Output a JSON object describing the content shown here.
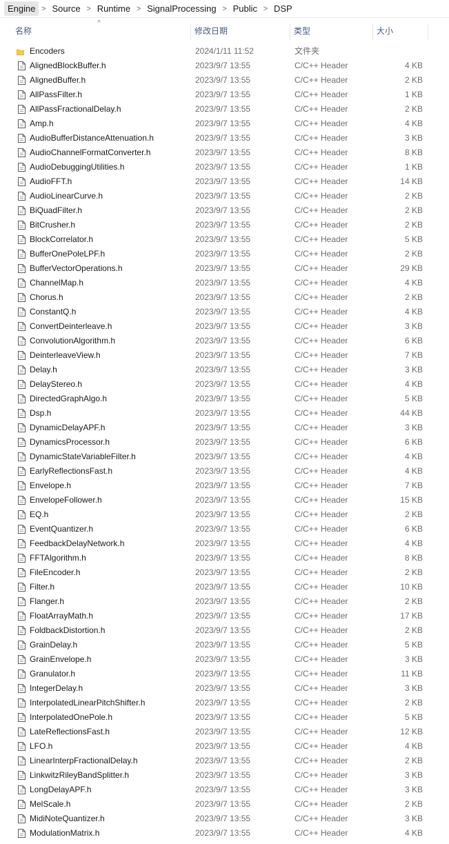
{
  "breadcrumb": [
    "Engine",
    "Source",
    "Runtime",
    "SignalProcessing",
    "Public",
    "DSP"
  ],
  "breadcrumb_separator": ">",
  "columns": {
    "name": "名称",
    "date": "修改日期",
    "type": "类型",
    "size": "大小"
  },
  "sort_indicator": "^",
  "icons": {
    "folder": "folder-icon",
    "file": "header-file-icon",
    "folder_color": "#f4c94e",
    "file_color": "#5a5a5a"
  },
  "files": [
    {
      "name": "Encoders",
      "date": "2024/1/11 11:52",
      "type": "文件夹",
      "size": "",
      "kind": "folder"
    },
    {
      "name": "AlignedBlockBuffer.h",
      "date": "2023/9/7 13:55",
      "type": "C/C++ Header",
      "size": "4 KB",
      "kind": "file"
    },
    {
      "name": "AlignedBuffer.h",
      "date": "2023/9/7 13:55",
      "type": "C/C++ Header",
      "size": "2 KB",
      "kind": "file"
    },
    {
      "name": "AllPassFilter.h",
      "date": "2023/9/7 13:55",
      "type": "C/C++ Header",
      "size": "1 KB",
      "kind": "file"
    },
    {
      "name": "AllPassFractionalDelay.h",
      "date": "2023/9/7 13:55",
      "type": "C/C++ Header",
      "size": "2 KB",
      "kind": "file"
    },
    {
      "name": "Amp.h",
      "date": "2023/9/7 13:55",
      "type": "C/C++ Header",
      "size": "4 KB",
      "kind": "file"
    },
    {
      "name": "AudioBufferDistanceAttenuation.h",
      "date": "2023/9/7 13:55",
      "type": "C/C++ Header",
      "size": "3 KB",
      "kind": "file"
    },
    {
      "name": "AudioChannelFormatConverter.h",
      "date": "2023/9/7 13:55",
      "type": "C/C++ Header",
      "size": "8 KB",
      "kind": "file"
    },
    {
      "name": "AudioDebuggingUtilities.h",
      "date": "2023/9/7 13:55",
      "type": "C/C++ Header",
      "size": "1 KB",
      "kind": "file"
    },
    {
      "name": "AudioFFT.h",
      "date": "2023/9/7 13:55",
      "type": "C/C++ Header",
      "size": "14 KB",
      "kind": "file"
    },
    {
      "name": "AudioLinearCurve.h",
      "date": "2023/9/7 13:55",
      "type": "C/C++ Header",
      "size": "2 KB",
      "kind": "file"
    },
    {
      "name": "BiQuadFilter.h",
      "date": "2023/9/7 13:55",
      "type": "C/C++ Header",
      "size": "2 KB",
      "kind": "file"
    },
    {
      "name": "BitCrusher.h",
      "date": "2023/9/7 13:55",
      "type": "C/C++ Header",
      "size": "2 KB",
      "kind": "file"
    },
    {
      "name": "BlockCorrelator.h",
      "date": "2023/9/7 13:55",
      "type": "C/C++ Header",
      "size": "5 KB",
      "kind": "file"
    },
    {
      "name": "BufferOnePoleLPF.h",
      "date": "2023/9/7 13:55",
      "type": "C/C++ Header",
      "size": "2 KB",
      "kind": "file"
    },
    {
      "name": "BufferVectorOperations.h",
      "date": "2023/9/7 13:55",
      "type": "C/C++ Header",
      "size": "29 KB",
      "kind": "file"
    },
    {
      "name": "ChannelMap.h",
      "date": "2023/9/7 13:55",
      "type": "C/C++ Header",
      "size": "4 KB",
      "kind": "file"
    },
    {
      "name": "Chorus.h",
      "date": "2023/9/7 13:55",
      "type": "C/C++ Header",
      "size": "2 KB",
      "kind": "file"
    },
    {
      "name": "ConstantQ.h",
      "date": "2023/9/7 13:55",
      "type": "C/C++ Header",
      "size": "4 KB",
      "kind": "file"
    },
    {
      "name": "ConvertDeinterleave.h",
      "date": "2023/9/7 13:55",
      "type": "C/C++ Header",
      "size": "3 KB",
      "kind": "file"
    },
    {
      "name": "ConvolutionAlgorithm.h",
      "date": "2023/9/7 13:55",
      "type": "C/C++ Header",
      "size": "6 KB",
      "kind": "file"
    },
    {
      "name": "DeinterleaveView.h",
      "date": "2023/9/7 13:55",
      "type": "C/C++ Header",
      "size": "7 KB",
      "kind": "file"
    },
    {
      "name": "Delay.h",
      "date": "2023/9/7 13:55",
      "type": "C/C++ Header",
      "size": "3 KB",
      "kind": "file"
    },
    {
      "name": "DelayStereo.h",
      "date": "2023/9/7 13:55",
      "type": "C/C++ Header",
      "size": "4 KB",
      "kind": "file"
    },
    {
      "name": "DirectedGraphAlgo.h",
      "date": "2023/9/7 13:55",
      "type": "C/C++ Header",
      "size": "5 KB",
      "kind": "file"
    },
    {
      "name": "Dsp.h",
      "date": "2023/9/7 13:55",
      "type": "C/C++ Header",
      "size": "44 KB",
      "kind": "file"
    },
    {
      "name": "DynamicDelayAPF.h",
      "date": "2023/9/7 13:55",
      "type": "C/C++ Header",
      "size": "3 KB",
      "kind": "file"
    },
    {
      "name": "DynamicsProcessor.h",
      "date": "2023/9/7 13:55",
      "type": "C/C++ Header",
      "size": "6 KB",
      "kind": "file"
    },
    {
      "name": "DynamicStateVariableFilter.h",
      "date": "2023/9/7 13:55",
      "type": "C/C++ Header",
      "size": "4 KB",
      "kind": "file"
    },
    {
      "name": "EarlyReflectionsFast.h",
      "date": "2023/9/7 13:55",
      "type": "C/C++ Header",
      "size": "4 KB",
      "kind": "file"
    },
    {
      "name": "Envelope.h",
      "date": "2023/9/7 13:55",
      "type": "C/C++ Header",
      "size": "7 KB",
      "kind": "file"
    },
    {
      "name": "EnvelopeFollower.h",
      "date": "2023/9/7 13:55",
      "type": "C/C++ Header",
      "size": "15 KB",
      "kind": "file"
    },
    {
      "name": "EQ.h",
      "date": "2023/9/7 13:55",
      "type": "C/C++ Header",
      "size": "2 KB",
      "kind": "file"
    },
    {
      "name": "EventQuantizer.h",
      "date": "2023/9/7 13:55",
      "type": "C/C++ Header",
      "size": "6 KB",
      "kind": "file"
    },
    {
      "name": "FeedbackDelayNetwork.h",
      "date": "2023/9/7 13:55",
      "type": "C/C++ Header",
      "size": "4 KB",
      "kind": "file"
    },
    {
      "name": "FFTAlgorithm.h",
      "date": "2023/9/7 13:55",
      "type": "C/C++ Header",
      "size": "8 KB",
      "kind": "file"
    },
    {
      "name": "FileEncoder.h",
      "date": "2023/9/7 13:55",
      "type": "C/C++ Header",
      "size": "2 KB",
      "kind": "file"
    },
    {
      "name": "Filter.h",
      "date": "2023/9/7 13:55",
      "type": "C/C++ Header",
      "size": "10 KB",
      "kind": "file"
    },
    {
      "name": "Flanger.h",
      "date": "2023/9/7 13:55",
      "type": "C/C++ Header",
      "size": "2 KB",
      "kind": "file"
    },
    {
      "name": "FloatArrayMath.h",
      "date": "2023/9/7 13:55",
      "type": "C/C++ Header",
      "size": "17 KB",
      "kind": "file"
    },
    {
      "name": "FoldbackDistortion.h",
      "date": "2023/9/7 13:55",
      "type": "C/C++ Header",
      "size": "2 KB",
      "kind": "file"
    },
    {
      "name": "GrainDelay.h",
      "date": "2023/9/7 13:55",
      "type": "C/C++ Header",
      "size": "5 KB",
      "kind": "file"
    },
    {
      "name": "GrainEnvelope.h",
      "date": "2023/9/7 13:55",
      "type": "C/C++ Header",
      "size": "3 KB",
      "kind": "file"
    },
    {
      "name": "Granulator.h",
      "date": "2023/9/7 13:55",
      "type": "C/C++ Header",
      "size": "11 KB",
      "kind": "file"
    },
    {
      "name": "IntegerDelay.h",
      "date": "2023/9/7 13:55",
      "type": "C/C++ Header",
      "size": "3 KB",
      "kind": "file"
    },
    {
      "name": "InterpolatedLinearPitchShifter.h",
      "date": "2023/9/7 13:55",
      "type": "C/C++ Header",
      "size": "2 KB",
      "kind": "file"
    },
    {
      "name": "InterpolatedOnePole.h",
      "date": "2023/9/7 13:55",
      "type": "C/C++ Header",
      "size": "5 KB",
      "kind": "file"
    },
    {
      "name": "LateReflectionsFast.h",
      "date": "2023/9/7 13:55",
      "type": "C/C++ Header",
      "size": "12 KB",
      "kind": "file"
    },
    {
      "name": "LFO.h",
      "date": "2023/9/7 13:55",
      "type": "C/C++ Header",
      "size": "4 KB",
      "kind": "file"
    },
    {
      "name": "LinearInterpFractionalDelay.h",
      "date": "2023/9/7 13:55",
      "type": "C/C++ Header",
      "size": "2 KB",
      "kind": "file"
    },
    {
      "name": "LinkwitzRileyBandSplitter.h",
      "date": "2023/9/7 13:55",
      "type": "C/C++ Header",
      "size": "3 KB",
      "kind": "file"
    },
    {
      "name": "LongDelayAPF.h",
      "date": "2023/9/7 13:55",
      "type": "C/C++ Header",
      "size": "3 KB",
      "kind": "file"
    },
    {
      "name": "MelScale.h",
      "date": "2023/9/7 13:55",
      "type": "C/C++ Header",
      "size": "2 KB",
      "kind": "file"
    },
    {
      "name": "MidiNoteQuantizer.h",
      "date": "2023/9/7 13:55",
      "type": "C/C++ Header",
      "size": "3 KB",
      "kind": "file"
    },
    {
      "name": "ModulationMatrix.h",
      "date": "2023/9/7 13:55",
      "type": "C/C++ Header",
      "size": "4 KB",
      "kind": "file"
    }
  ]
}
